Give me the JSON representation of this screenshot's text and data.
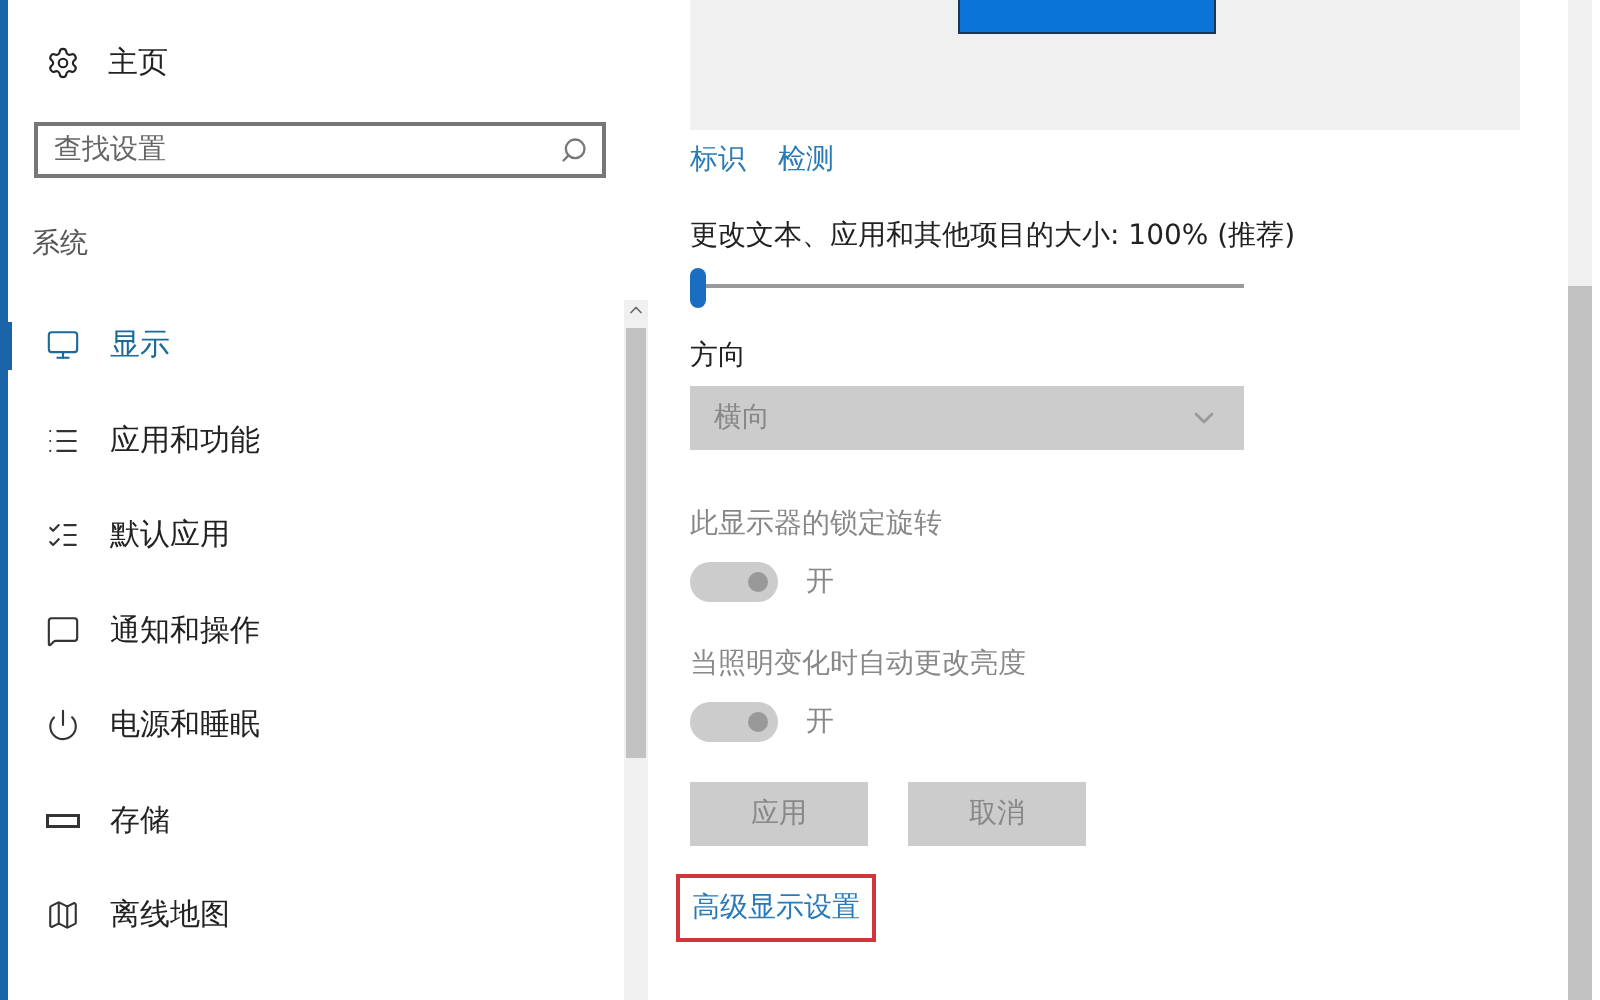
{
  "sidebar": {
    "home": {
      "label": "主页"
    },
    "search": {
      "placeholder": "查找设置"
    },
    "section": "系统",
    "items": [
      {
        "label": "显示",
        "selected": true
      },
      {
        "label": "应用和功能",
        "selected": false
      },
      {
        "label": "默认应用",
        "selected": false
      },
      {
        "label": "通知和操作",
        "selected": false
      },
      {
        "label": "电源和睡眠",
        "selected": false
      },
      {
        "label": "存储",
        "selected": false
      },
      {
        "label": "离线地图",
        "selected": false
      }
    ]
  },
  "display": {
    "links": [
      "标识",
      "检测"
    ],
    "scale": {
      "label": "更改文本、应用和其他项目的大小: 100% (推荐)",
      "level": 0
    },
    "orientation": {
      "label": "方向",
      "value": "横向",
      "disabled": true
    },
    "toggles": [
      {
        "label": "此显示器的锁定旋转",
        "state": "开",
        "on": true,
        "disabled": true
      },
      {
        "label": "当照明变化时自动更改亮度",
        "state": "开",
        "on": true,
        "disabled": true
      }
    ],
    "buttons": [
      {
        "label": "应用",
        "disabled": true
      },
      {
        "label": "取消",
        "disabled": true
      }
    ],
    "advanced_link": {
      "label": "高级显示设置",
      "highlighted": true
    }
  }
}
